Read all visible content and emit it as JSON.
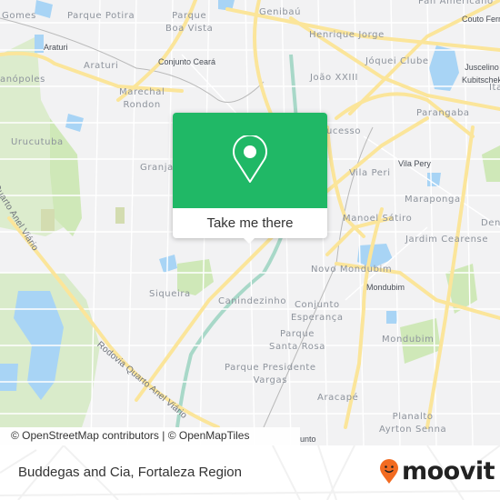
{
  "map": {
    "neighborhoods": [
      {
        "id": "gomes",
        "label": "Gomes"
      },
      {
        "id": "parque-potira",
        "label": "Parque Potira"
      },
      {
        "id": "parque-boa-vista",
        "label": "Parque\nBoa Vista"
      },
      {
        "id": "genibau",
        "label": "Genibaú"
      },
      {
        "id": "pan-americano",
        "label": "Pan Americano"
      },
      {
        "id": "henrique-jorge",
        "label": "Henrique Jorge"
      },
      {
        "id": "araturi",
        "label": "Araturi"
      },
      {
        "id": "jockey-clube",
        "label": "Jóquei Clube"
      },
      {
        "id": "anopoles",
        "label": "anópoles"
      },
      {
        "id": "joao-xxiii",
        "label": "João XXIII"
      },
      {
        "id": "marechal-rondon",
        "label": "Marechal\nRondon"
      },
      {
        "id": "parangaba",
        "label": "Parangaba"
      },
      {
        "id": "urucutuba",
        "label": "Urucutuba"
      },
      {
        "id": "sucesso",
        "label": "Sucesso"
      },
      {
        "id": "granja",
        "label": "Granja"
      },
      {
        "id": "vila-peri",
        "label": "Vila Peri"
      },
      {
        "id": "maraponga",
        "label": "Maraponga"
      },
      {
        "id": "manoel-satiro",
        "label": "Manoel Sátiro"
      },
      {
        "id": "den",
        "label": "Den"
      },
      {
        "id": "jardim-cearense",
        "label": "Jardim Cearense"
      },
      {
        "id": "novo-mondubim",
        "label": "Novo Mondubim"
      },
      {
        "id": "siqueira",
        "label": "Siqueira"
      },
      {
        "id": "canindezinho",
        "label": "Canindezinho"
      },
      {
        "id": "conjunto-esperanca",
        "label": "Conjunto\nEsperança"
      },
      {
        "id": "mondubim",
        "label": "Mondubim"
      },
      {
        "id": "parque-santa-rosa",
        "label": "Parque\nSanta Rosa"
      },
      {
        "id": "parque-presidente-vargas",
        "label": "Parque Presidente\nVargas"
      },
      {
        "id": "aracape",
        "label": "Aracapé"
      },
      {
        "id": "planalto-ayrton-senna",
        "label": "Planalto\nAyrton Senna"
      },
      {
        "id": "ita",
        "label": "Ita"
      }
    ],
    "poi_labels": [
      {
        "id": "araturi-poi",
        "label": "Araturi"
      },
      {
        "id": "conjunto-ceara",
        "label": "Conjunto Ceará"
      },
      {
        "id": "couto-fernandes",
        "label": "Couto Fern"
      },
      {
        "id": "juscelino-kubitschek",
        "label": "Juscelino\nKubitschek"
      },
      {
        "id": "vila-pery",
        "label": "Vila Pery"
      },
      {
        "id": "mondubim-poi",
        "label": "Mondubim"
      },
      {
        "id": "conjunto-partial",
        "label": "unto"
      }
    ],
    "road_labels": [
      {
        "id": "rodovia-upper",
        "label": "Quarto Anel Viário"
      },
      {
        "id": "rodovia-lower",
        "label": "Rodovia Quarto Anel Viário"
      }
    ],
    "colors": {
      "land": "#f2f2f3",
      "major_road": "#fbe59a",
      "minor_road": "#ffffff",
      "water": "#a8d4f5",
      "park": "#c9e6b0"
    },
    "attribution": "© OpenStreetMap contributors | © OpenMapTiles"
  },
  "popup": {
    "icon": "map-pin-icon",
    "action_label": "Take me there",
    "accent_color": "#20b866"
  },
  "footer": {
    "place_name": "Buddegas and Cia, Fortaleza Region",
    "brand": "moovit",
    "brand_color": "#f26b21"
  }
}
